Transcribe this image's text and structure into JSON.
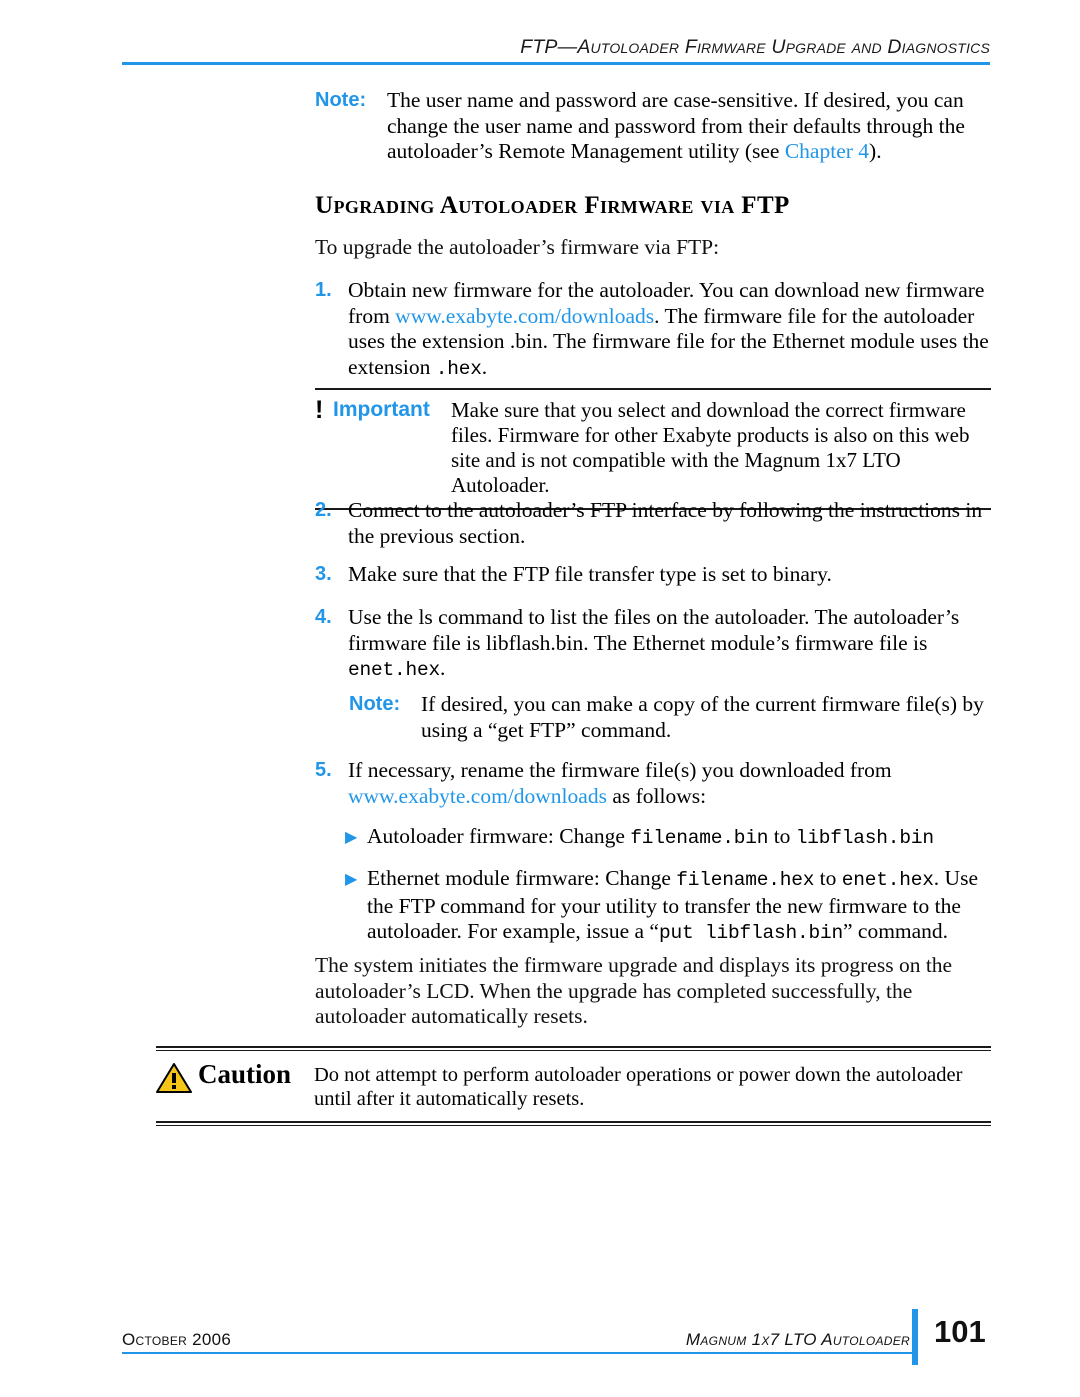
{
  "header": {
    "running_head": "FTP—Autoloader Firmware Upgrade and Diagnostics",
    "rule_color": "#2196e8"
  },
  "note_top": {
    "label": "Note:",
    "text_part1": "The user name and password are case-sensitive. If desired, you can change the user name and password from their defaults through the autoloader’s Remote Management utility (see ",
    "link": "Chapter 4",
    "text_part2": ")."
  },
  "section": {
    "heading": "Upgrading Autoloader Firmware via FTP",
    "intro": "To upgrade the autoloader’s firmware via FTP:"
  },
  "steps": [
    {
      "number": "1.",
      "text_part1": "Obtain new firmware for the autoloader. You can download new firmware from ",
      "link": "www.exabyte.com/downloads",
      "text_part2": ". The firmware file for the autoloader uses the extension .bin. The firmware file for the Ethernet module uses the extension ",
      "mono1": ".hex",
      "text_part3": "."
    },
    {
      "number": "2.",
      "text_part1": "Connect to the autoloader’s FTP interface by following the instructions in the previous section."
    },
    {
      "number": "3.",
      "text_part1": "Make sure that the FTP file transfer type is set to binary."
    },
    {
      "number": "4.",
      "text_part1": "Use the ls command to list the files on the autoloader. The autoloader’s firmware file is libflash.bin. The Ethernet module’s firmware file is ",
      "mono1": "enet.hex",
      "text_part2": "."
    },
    {
      "number": "5.",
      "text_part1": "If necessary, rename the firmware file(s) you downloaded from ",
      "link": "www.exabyte.com/downloads",
      "text_part2": " as follows:"
    }
  ],
  "note_step4": {
    "label": "Note:",
    "text": "If desired, you can make a copy of the current firmware file(s) by using a “get FTP” command."
  },
  "bullets": [
    {
      "mark": "▶",
      "text_part1": "Autoloader firmware: Change ",
      "mono1": "filename.bin",
      "text_part2": " to ",
      "mono2": "libflash.bin"
    },
    {
      "mark": "▶",
      "text_part1": "Ethernet module firmware: Change ",
      "mono1": "filename.hex",
      "text_part2": " to ",
      "mono2": "enet.hex",
      "text_part3": ". Use the FTP command for your utility to transfer the new firmware to the autoloader. For example, issue a “",
      "mono3": "put libflash.bin",
      "text_part4": "” command."
    }
  ],
  "closing_paragraph": "The system initiates the firmware upgrade and displays its progress on the autoloader’s LCD. When the upgrade has completed successfully, the autoloader automatically resets.",
  "important": {
    "bang": "!",
    "label": "Important",
    "text": "Make sure that you select and download the correct firmware files. Firmware for other Exabyte products is also on this web site and is not compatible with the Magnum 1x7 LTO Autoloader."
  },
  "caution": {
    "label": "Caution",
    "text": "Do not attempt to perform autoloader operations or power down the autoloader until after it automatically resets.",
    "icon_fill": "#f5c518",
    "icon_name": "warning-triangle-icon"
  },
  "footer": {
    "left": "October 2006",
    "right": "Magnum 1x7 LTO Autoloader",
    "page_number": "101",
    "accent_color": "#2196e8"
  },
  "colors": {
    "accent_blue": "#2196e8",
    "text_black": "#111111",
    "caution_yellow": "#f5c518"
  }
}
